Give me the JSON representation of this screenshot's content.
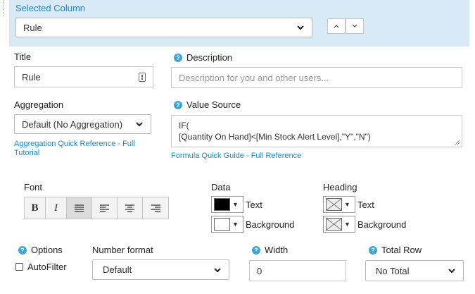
{
  "selected_column": {
    "heading": "Selected Column",
    "value": "Rule",
    "up_icon": "chevron-up-icon",
    "down_icon": "chevron-down-icon"
  },
  "title": {
    "label": "Title",
    "value": "Rule"
  },
  "description": {
    "label": "Description",
    "placeholder": "Description for you and other users..."
  },
  "aggregation": {
    "label": "Aggregation",
    "value": "Default (No Aggregation)",
    "link": "Aggregation Quick Reference - Full Tutorial"
  },
  "value_source": {
    "label": "Value Source",
    "line1": "IF(",
    "line2": "[Quantity On Hand]<[Min Stock Alert Level],\"Y\",\"N\")",
    "link": "Formula Quick Guide - Full Reference"
  },
  "font": {
    "label": "Font",
    "bold": "B",
    "italic": "I"
  },
  "data_colors": {
    "label": "Data",
    "text_label": "Text",
    "background_label": "Background",
    "text_color": "#000000",
    "background_color": "#ffffff"
  },
  "heading_colors": {
    "label": "Heading",
    "text_label": "Text",
    "background_label": "Background"
  },
  "options": {
    "label": "Options",
    "autofilter_label": "AutoFilter"
  },
  "number_format": {
    "label": "Number format",
    "value": "Default"
  },
  "width": {
    "label": "Width",
    "value": "0"
  },
  "total_row": {
    "label": "Total Row",
    "value": "No Total"
  },
  "colors": {
    "accent": "#1e88c8",
    "panel": "#d8eaf6",
    "help_icon": "#3ba5de"
  }
}
